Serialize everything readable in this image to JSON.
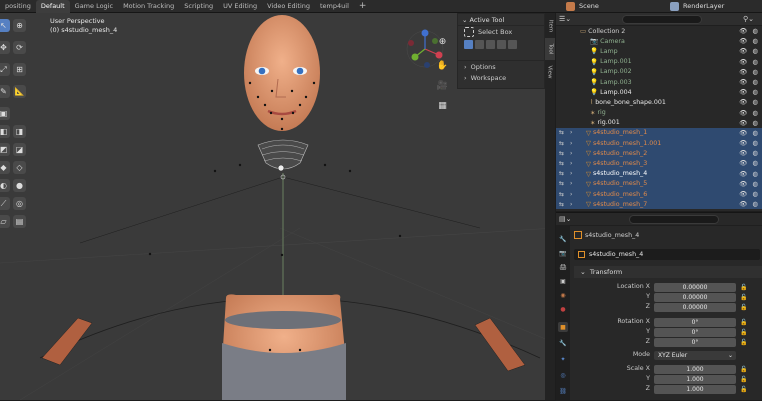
{
  "topbar": {
    "tabs": [
      "positing",
      "Default",
      "Game Logic",
      "Motion Tracking",
      "Scripting",
      "UV Editing",
      "Video Editing",
      "temp4uil"
    ],
    "active_index": 1,
    "plus": "+"
  },
  "viewport": {
    "perspective": "User Perspective",
    "object_label": "(0) s4studio_mesh_4"
  },
  "npanel": {
    "active_tool_header": "Active Tool",
    "select_box": "Select Box",
    "options": "Options",
    "workspace": "Workspace"
  },
  "sidetabs": {
    "item": "Item",
    "tool": "Tool",
    "view": "View"
  },
  "outliner": {
    "scene": "Scene",
    "render_layer": "RenderLayer",
    "rows": [
      {
        "label": "Collection 2",
        "color": "#d0d0d0",
        "icon": "collection-icon",
        "sel": false
      },
      {
        "label": "Camera",
        "color": "#8fb08f",
        "icon": "camera-icon",
        "sel": false
      },
      {
        "label": "Lamp",
        "color": "#8fb08f",
        "icon": "lamp-icon",
        "sel": false
      },
      {
        "label": "Lamp.001",
        "color": "#8fb08f",
        "icon": "lamp-icon",
        "sel": false
      },
      {
        "label": "Lamp.002",
        "color": "#8fb08f",
        "icon": "lamp-icon",
        "sel": false
      },
      {
        "label": "Lamp.003",
        "color": "#8fb08f",
        "icon": "lamp-icon",
        "sel": false
      },
      {
        "label": "Lamp.004",
        "color": "#e8e8e8",
        "icon": "lamp-icon",
        "sel": false
      },
      {
        "label": "bone_bone_shape.001",
        "color": "#e8e8e8",
        "icon": "bone-icon",
        "sel": false
      },
      {
        "label": "rig",
        "color": "#8fb08f",
        "icon": "armature-icon",
        "sel": false
      },
      {
        "label": "rig.001",
        "color": "#e8e8e8",
        "icon": "armature-icon",
        "sel": false
      },
      {
        "label": "s4studio_mesh_1",
        "color": "#e08a4a",
        "icon": "mesh-icon",
        "sel": true
      },
      {
        "label": "s4studio_mesh_1.001",
        "color": "#e08a4a",
        "icon": "mesh-icon",
        "sel": true
      },
      {
        "label": "s4studio_mesh_2",
        "color": "#e08a4a",
        "icon": "mesh-icon",
        "sel": true
      },
      {
        "label": "s4studio_mesh_3",
        "color": "#e08a4a",
        "icon": "mesh-icon",
        "sel": true
      },
      {
        "label": "s4studio_mesh_4",
        "color": "#ffffff",
        "icon": "mesh-icon",
        "sel": true
      },
      {
        "label": "s4studio_mesh_5",
        "color": "#e08a4a",
        "icon": "mesh-icon",
        "sel": true
      },
      {
        "label": "s4studio_mesh_6",
        "color": "#e08a4a",
        "icon": "mesh-icon",
        "sel": true
      },
      {
        "label": "s4studio_mesh_7",
        "color": "#e08a4a",
        "icon": "mesh-icon",
        "sel": true
      }
    ]
  },
  "properties": {
    "object_name": "s4studio_mesh_4",
    "object_field": "s4studio_mesh_4",
    "section": "Transform",
    "location_label": "Location X",
    "rotation_label": "Rotation X",
    "mode_label": "Mode",
    "scale_label": "Scale X",
    "y": "Y",
    "z": "Z",
    "location": [
      "0.00000",
      "0.00000",
      "0.00000"
    ],
    "rotation": [
      "0°",
      "0°",
      "0°"
    ],
    "mode": "XYZ Euler",
    "scale": [
      "1.000",
      "1.000",
      "1.000"
    ]
  },
  "colors": {
    "selected_row": "#2f4a70",
    "accent": "#5680c2",
    "mesh_text": "#e08a4a"
  }
}
